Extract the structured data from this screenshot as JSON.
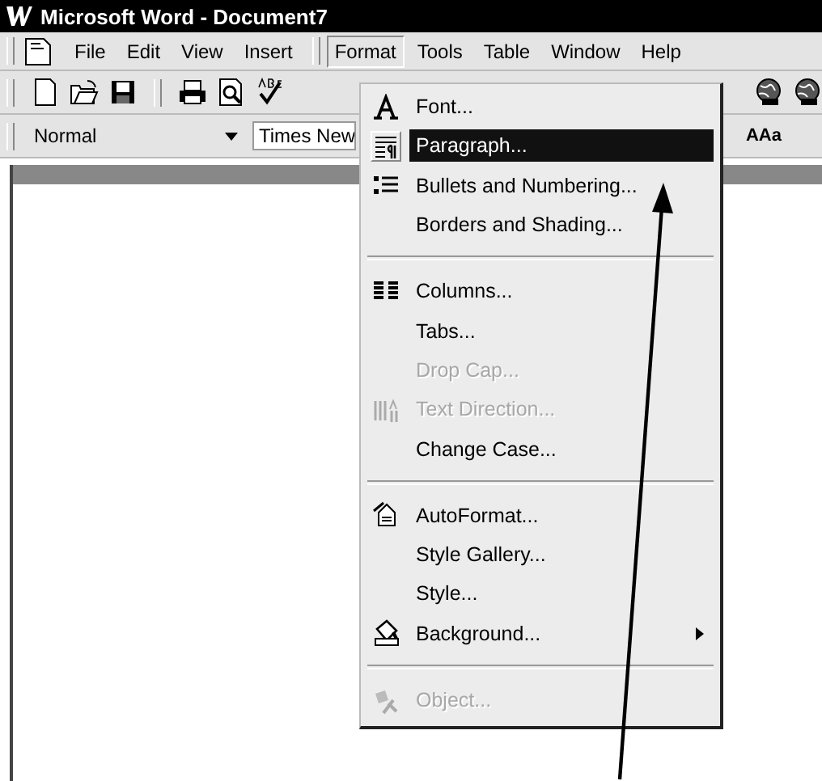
{
  "window": {
    "title": "Microsoft Word - Document7"
  },
  "menu_bar": {
    "items": [
      {
        "label": "File",
        "selected": false
      },
      {
        "label": "Edit",
        "selected": false
      },
      {
        "label": "View",
        "selected": false
      },
      {
        "label": "Insert",
        "selected": false
      },
      {
        "label": "Format",
        "selected": true
      },
      {
        "label": "Tools",
        "selected": false
      },
      {
        "label": "Table",
        "selected": false
      },
      {
        "label": "Window",
        "selected": false
      },
      {
        "label": "Help",
        "selected": false
      }
    ]
  },
  "formatting_toolbar": {
    "style": "Normal",
    "font": "Times New",
    "style_gallery_button": "AAa"
  },
  "format_menu": {
    "items": [
      {
        "kind": "item",
        "label": "Font...",
        "disabled": false,
        "selected": false,
        "submenu": false
      },
      {
        "kind": "item",
        "label": "Paragraph...",
        "disabled": false,
        "selected": true,
        "submenu": false
      },
      {
        "kind": "item",
        "label": "Bullets and Numbering...",
        "disabled": false,
        "selected": false,
        "submenu": false
      },
      {
        "kind": "item",
        "label": "Borders and Shading...",
        "disabled": false,
        "selected": false,
        "submenu": false
      },
      {
        "kind": "separator"
      },
      {
        "kind": "item",
        "label": "Columns...",
        "disabled": false,
        "selected": false,
        "submenu": false
      },
      {
        "kind": "item",
        "label": "Tabs...",
        "disabled": false,
        "selected": false,
        "submenu": false
      },
      {
        "kind": "item",
        "label": "Drop Cap...",
        "disabled": true,
        "selected": false,
        "submenu": false
      },
      {
        "kind": "item",
        "label": "Text Direction...",
        "disabled": true,
        "selected": false,
        "submenu": false
      },
      {
        "kind": "item",
        "label": "Change Case...",
        "disabled": false,
        "selected": false,
        "submenu": false
      },
      {
        "kind": "separator"
      },
      {
        "kind": "item",
        "label": "AutoFormat...",
        "disabled": false,
        "selected": false,
        "submenu": false
      },
      {
        "kind": "item",
        "label": "Style Gallery...",
        "disabled": false,
        "selected": false,
        "submenu": false
      },
      {
        "kind": "item",
        "label": "Style...",
        "disabled": false,
        "selected": false,
        "submenu": false
      },
      {
        "kind": "item",
        "label": "Background...",
        "disabled": false,
        "selected": false,
        "submenu": true
      },
      {
        "kind": "separator"
      },
      {
        "kind": "item",
        "label": "Object...",
        "disabled": true,
        "selected": false,
        "submenu": false
      }
    ]
  }
}
